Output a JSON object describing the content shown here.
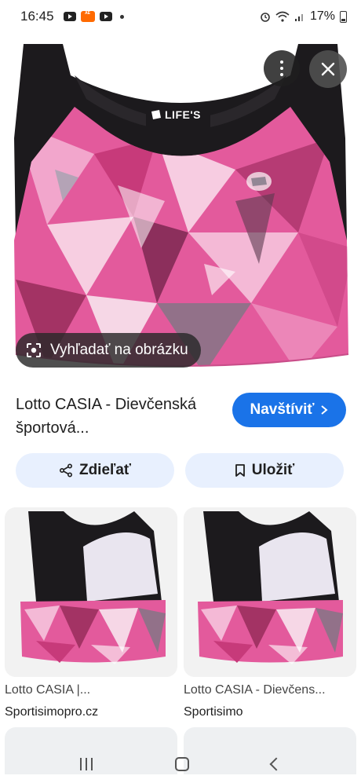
{
  "status_bar": {
    "time": "16:45",
    "notification_icons": [
      "youtube-icon",
      "aliexpress-icon",
      "youtube-icon"
    ],
    "system_icons": [
      "alarm-icon",
      "wifi-icon",
      "signal-icon"
    ],
    "battery": "17%"
  },
  "hero": {
    "product_image": "pink geometric pattern sports bra with black straps",
    "brand_label": "LIFE'S",
    "lens_chip_label": "Vyhľadať na obrázku"
  },
  "result": {
    "title": "Lotto CASIA - Dievčenská športová...",
    "visit_label": "Navštíviť",
    "share_label": "Zdieľať",
    "save_label": "Uložiť"
  },
  "related": [
    {
      "title": "Lotto CASIA |...",
      "source": "Sportisimopro.cz"
    },
    {
      "title": "Lotto CASIA - Dievčens...",
      "source": "Sportisimo"
    }
  ],
  "colors": {
    "accent": "#1a73e8",
    "pill_bg": "#e8f0fe",
    "bra_pink": "#e35a9c",
    "bra_black": "#1c1a1d"
  }
}
